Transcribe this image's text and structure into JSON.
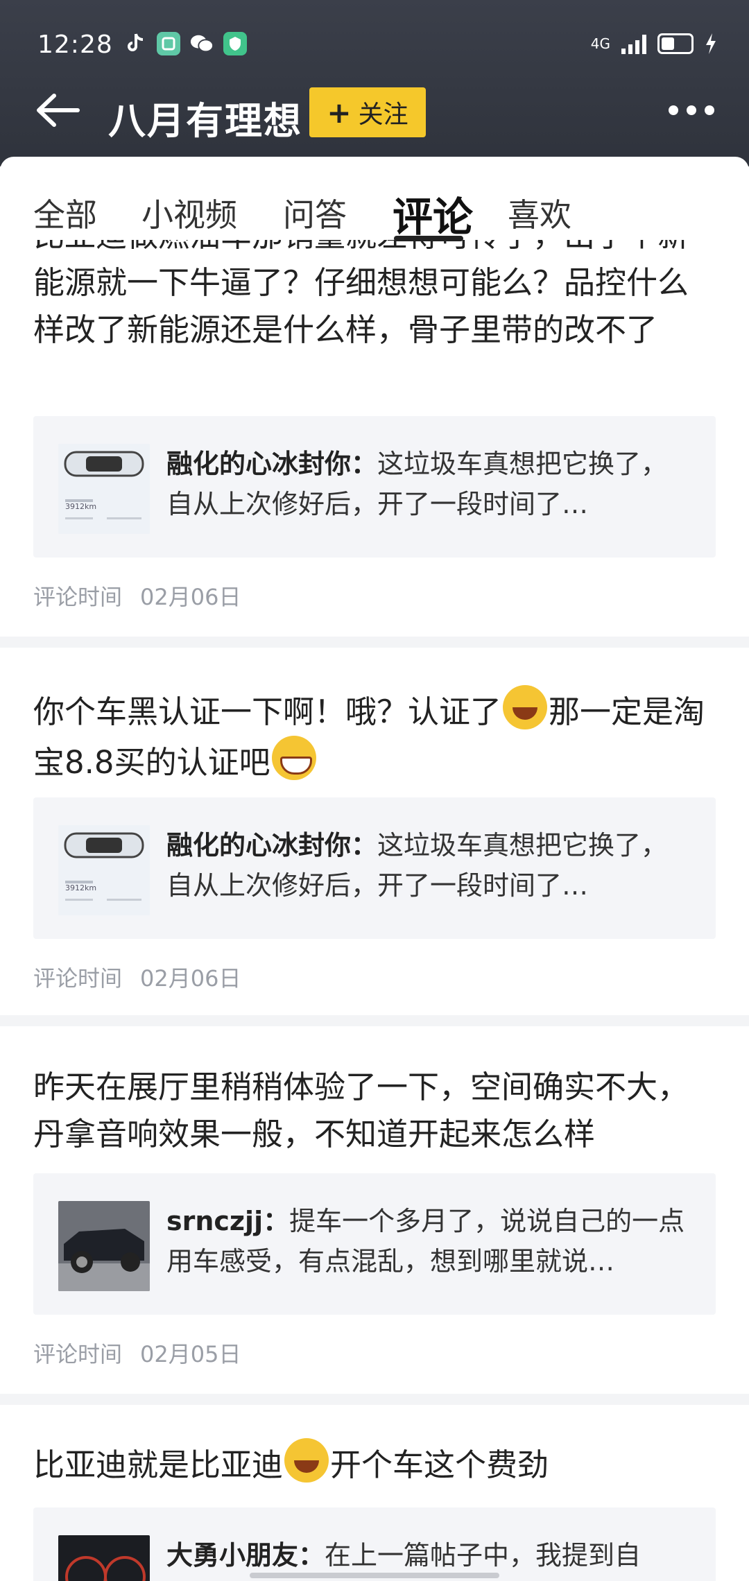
{
  "status_bar": {
    "time": "12:28",
    "network": "4G",
    "icons": [
      "tiktok-icon",
      "app-icon",
      "wechat-icon",
      "shield-app-icon"
    ]
  },
  "header": {
    "title": "八月有理想",
    "follow_label": "关注",
    "follow_plus": "+"
  },
  "tabs": [
    {
      "label": "全部"
    },
    {
      "label": "小视频"
    },
    {
      "label": "问答"
    },
    {
      "label": "评论",
      "active": true
    },
    {
      "label": "喜欢"
    }
  ],
  "items": [
    {
      "comment_clipped": "比亚迪做燃油车那销量就差得可怜了，出了个新",
      "comment": "能源就一下牛逼了？仔细想想可能么？品控什么样改了新能源还是什么样，骨子里带的改不了",
      "quote_author": "融化的心冰封你：",
      "quote_text": "这垃圾车真想把它换了，自从上次修好后，开了一段时间了…",
      "thumb_text": "3912km",
      "time_label": "评论时间",
      "time": "02月06日"
    },
    {
      "comment_a": "你个车黑认证一下啊！哦？认证了",
      "comment_b": "那一定是淘宝8.8买的认证吧",
      "quote_author": "融化的心冰封你：",
      "quote_text": "这垃圾车真想把它换了，自从上次修好后，开了一段时间了…",
      "thumb_text": "3912km",
      "time_label": "评论时间",
      "time": "02月06日"
    },
    {
      "comment": "昨天在展厅里稍稍体验了一下，空间确实不大，丹拿音响效果一般，不知道开起来怎么样",
      "quote_author": "srnczjj：",
      "quote_text": "提车一个多月了，说说自己的一点用车感受，有点混乱，想到哪里就说…",
      "time_label": "评论时间",
      "time": "02月05日"
    },
    {
      "comment_a": "比亚迪就是比亚迪",
      "comment_b": "开个车这个费劲",
      "quote_author": "大勇小朋友：",
      "quote_text": "在上一篇帖子中，我提到自"
    }
  ]
}
